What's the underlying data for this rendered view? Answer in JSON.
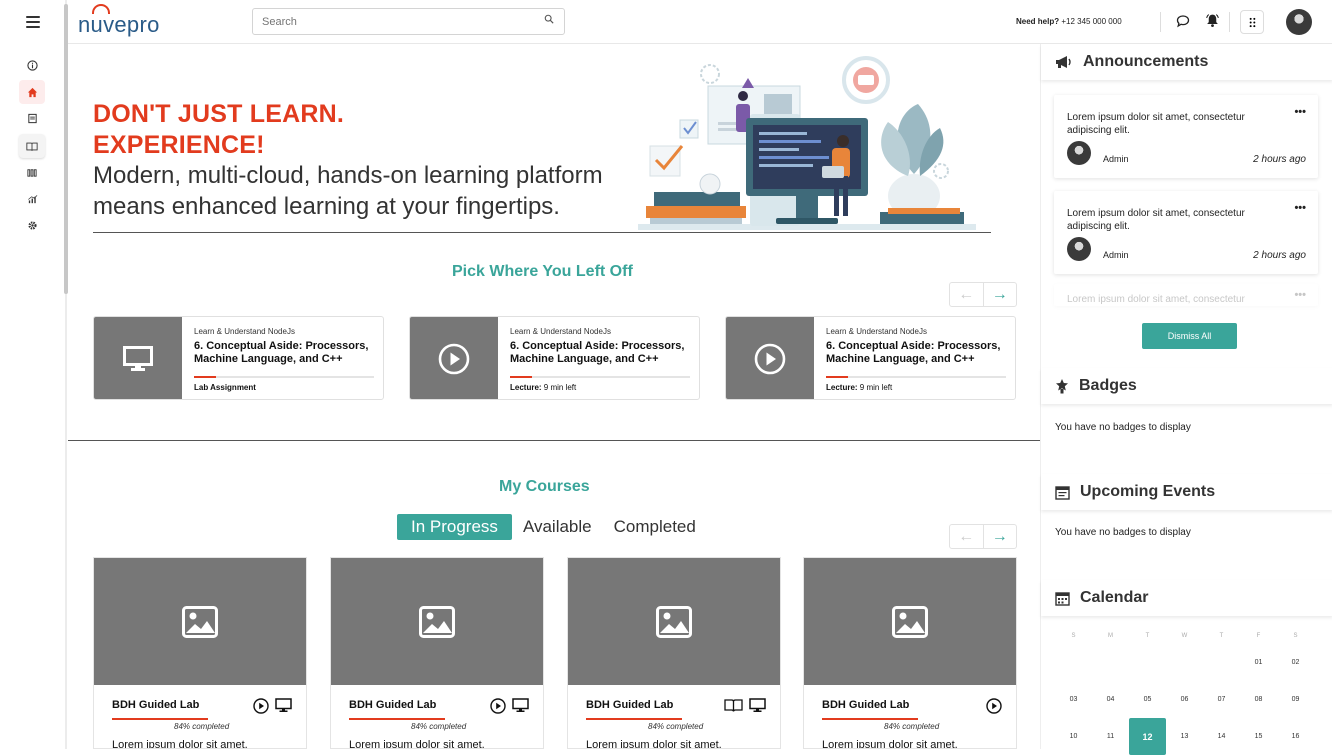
{
  "brand": {
    "logo_text": "nuvepro",
    "accent": "#3aa59a",
    "red": "#e23b1e"
  },
  "header": {
    "search_placeholder": "Search",
    "help_label": "Need help?",
    "help_phone": "+12 345 000 000",
    "icons": [
      "chat-icon",
      "bell-icon",
      "apps-grid-icon"
    ]
  },
  "sidebar": {
    "items": [
      "info-icon",
      "home-icon",
      "document-icon",
      "book-icon",
      "library-icon",
      "analytics-icon",
      "settings-icon"
    ],
    "active": "home-icon"
  },
  "hero": {
    "title_line1": "DON'T JUST LEARN.",
    "title_line2": "EXPERIENCE!",
    "subtitle_line1": "Modern, multi-cloud, hands-on learning platform",
    "subtitle_line2": "means enhanced learning at your fingertips."
  },
  "pick_up": {
    "title": "Pick Where You Left  Off",
    "cards": [
      {
        "course": "Learn & Understand NodeJs",
        "title": "6. Conceptual Aside: Processors, Machine Language, and C++",
        "meta_label": "Lab Assignment",
        "meta_value": "",
        "icon": "monitor-icon",
        "progress": 0.12
      },
      {
        "course": "Learn & Understand NodeJs",
        "title": "6. Conceptual Aside: Processors, Machine Language, and C++",
        "meta_label": "Lecture:",
        "meta_value": "9 min left",
        "icon": "play-icon",
        "progress": 0.12
      },
      {
        "course": "Learn & Understand NodeJs",
        "title": "6. Conceptual Aside: Processors, Machine Language, and C++",
        "meta_label": "Lecture:",
        "meta_value": "9 min left",
        "icon": "play-icon",
        "progress": 0.12
      }
    ]
  },
  "my_courses": {
    "title": "My Courses",
    "tabs": [
      "In Progress",
      "Available",
      "Completed"
    ],
    "active_tab": "In Progress",
    "cards": [
      {
        "name": "BDH Guided Lab",
        "completed": "84% completed",
        "desc": "Lorem ipsum dolor sit amet,",
        "icons": [
          "play-icon",
          "monitor-icon"
        ]
      },
      {
        "name": "BDH Guided Lab",
        "completed": "84% completed",
        "desc": "Lorem ipsum dolor sit amet,",
        "icons": [
          "play-icon",
          "monitor-icon"
        ]
      },
      {
        "name": "BDH Guided Lab",
        "completed": "84% completed",
        "desc": "Lorem ipsum dolor sit amet,",
        "icons": [
          "book-icon",
          "monitor-icon"
        ]
      },
      {
        "name": "BDH Guided Lab",
        "completed": "84% completed",
        "desc": "Lorem ipsum dolor sit amet,",
        "icons": [
          "play-icon"
        ]
      }
    ]
  },
  "announcements": {
    "title": "Announcements",
    "items": [
      {
        "text": "Lorem ipsum dolor sit amet, consectetur adipiscing elit.",
        "author": "Admin",
        "time": "2 hours ago"
      },
      {
        "text": "Lorem ipsum dolor sit amet, consectetur adipiscing elit.",
        "author": "Admin",
        "time": "2 hours ago"
      }
    ],
    "faded_text": "Lorem ipsum dolor sit amet, consectetur",
    "dismiss_label": "Dismiss All"
  },
  "badges": {
    "title": "Badges",
    "empty": "You have no badges to display"
  },
  "events": {
    "title": "Upcoming Events",
    "empty": "You have no badges to display"
  },
  "calendar": {
    "title": "Calendar",
    "weekdays": [
      "S",
      "M",
      "T",
      "W",
      "T",
      "F",
      "S"
    ],
    "weeks": [
      [
        "",
        "",
        "",
        "",
        "",
        "01",
        "02"
      ],
      [
        "03",
        "04",
        "05",
        "06",
        "07",
        "08",
        "09"
      ],
      [
        "10",
        "11",
        "12",
        "13",
        "14",
        "15",
        "16"
      ]
    ],
    "selected": "12"
  }
}
